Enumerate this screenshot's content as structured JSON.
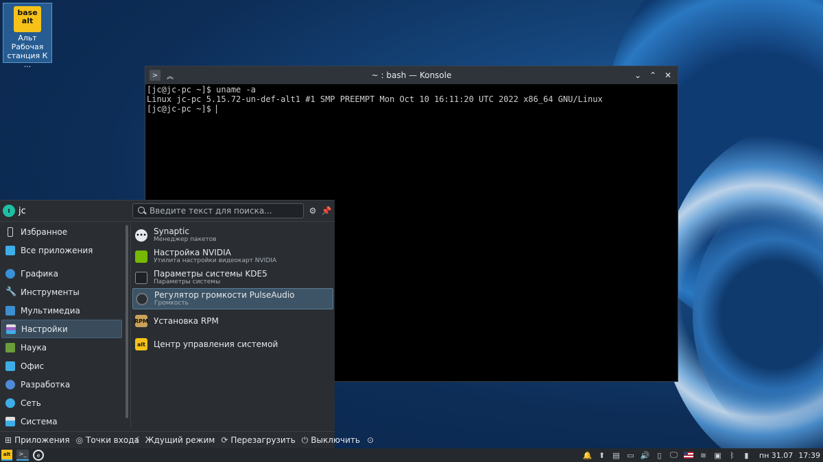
{
  "desktop": {
    "icon": {
      "logo_line1": "base",
      "logo_line2": "alt",
      "label": "Альт Рабочая станция К ..."
    }
  },
  "konsole": {
    "title": "~ : bash — Konsole",
    "lines": [
      "[jc@jc-pc ~]$ uname -a",
      "Linux jc-pc 5.15.72-un-def-alt1 #1 SMP PREEMPT Mon Oct 10 16:11:20 UTC 2022 x86_64 GNU/Linux",
      "[jc@jc-pc ~]$ "
    ]
  },
  "menu": {
    "user": "jc",
    "search_placeholder": "Введите текст для поиска...",
    "categories": [
      {
        "label": "Избранное",
        "icon": "bookmark-icon",
        "color": "#2b2f34"
      },
      {
        "label": "Все приложения",
        "icon": "grid-icon",
        "color": "#3daee9"
      },
      {
        "label": "Графика",
        "icon": "graphics-icon",
        "color": "#3a8fd6"
      },
      {
        "label": "Инструменты",
        "icon": "wrench-icon",
        "color": "#c9cdd1"
      },
      {
        "label": "Мультимедиа",
        "icon": "multimedia-icon",
        "color": "#3b8ed0"
      },
      {
        "label": "Настройки",
        "icon": "settings-icon",
        "color": "#9b5fc0"
      },
      {
        "label": "Наука",
        "icon": "science-icon",
        "color": "#6b9c3a"
      },
      {
        "label": "Офис",
        "icon": "office-icon",
        "color": "#3daee9"
      },
      {
        "label": "Разработка",
        "icon": "development-icon",
        "color": "#4f8ad6"
      },
      {
        "label": "Сеть",
        "icon": "network-icon",
        "color": "#3daee9"
      },
      {
        "label": "Система",
        "icon": "system-icon",
        "color": "#3daee9"
      }
    ],
    "apps": [
      {
        "name": "Synaptic",
        "desc": "Менеджер пакетов",
        "icon": "synaptic-icon",
        "color": "#e6e9ed",
        "glyph": "•••"
      },
      {
        "name": "Настройка NVIDIA",
        "desc": "Утилита настройки видеокарт NVIDIA",
        "icon": "nvidia-icon",
        "color": "#76b900",
        "glyph": ""
      },
      {
        "name": "Параметры системы KDE5",
        "desc": "Параметры системы",
        "icon": "kde-settings-icon",
        "color": "#1e2226",
        "glyph": ""
      },
      {
        "name": "Регулятор громкости PulseAudio",
        "desc": "Громкость",
        "icon": "volume-knob-icon",
        "color": "#2a2e33",
        "glyph": ""
      },
      {
        "name": "Установка RPM",
        "desc": "",
        "icon": "rpm-icon",
        "color": "#c9a15a",
        "glyph": "RPM"
      },
      {
        "name": "Центр управления системой",
        "desc": "",
        "icon": "control-center-icon",
        "color": "#f6c21a",
        "glyph": "alt"
      }
    ],
    "footer": {
      "applications": "Приложения",
      "places": "Точки входа",
      "sleep": "Ждущий режим",
      "reboot": "Перезагрузить",
      "shutdown": "Выключить"
    }
  },
  "taskbar": {
    "launcher_glyph": "alt",
    "clock_day": "пн 31.07",
    "clock_time": "17:39"
  }
}
